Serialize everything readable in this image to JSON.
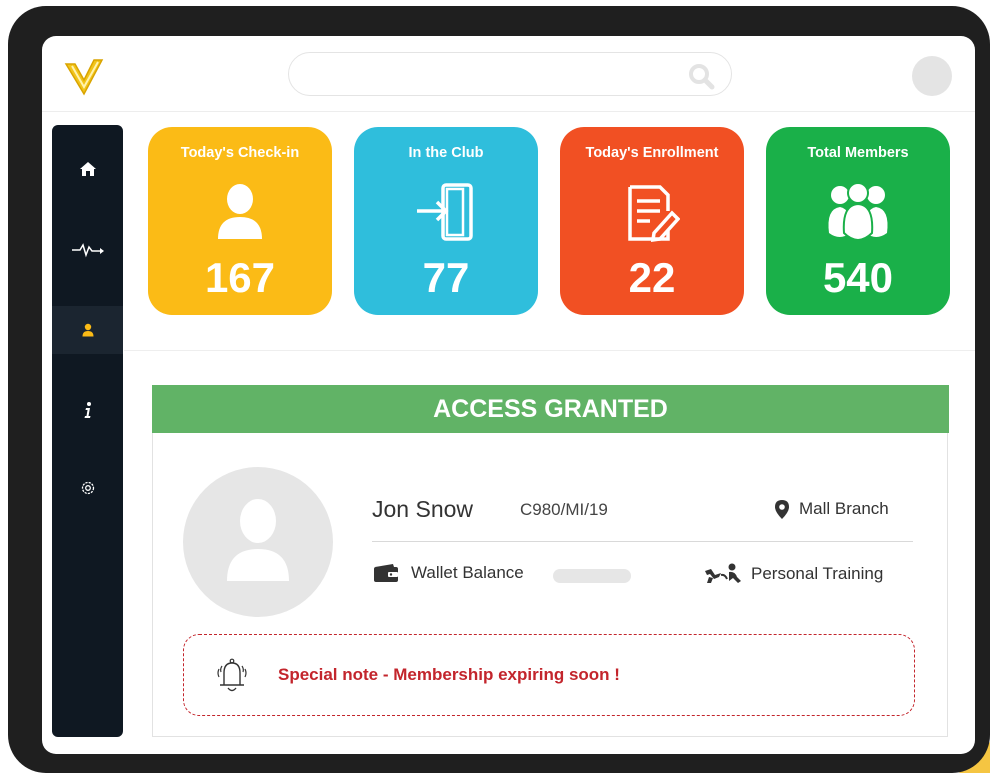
{
  "header": {
    "logo": "app-logo",
    "search_placeholder": ""
  },
  "sidebar": {
    "items": [
      {
        "name": "home",
        "icon": "home-icon",
        "active": false
      },
      {
        "name": "activity",
        "icon": "pulse-icon",
        "active": false
      },
      {
        "name": "members",
        "icon": "user-icon",
        "active": true
      },
      {
        "name": "info",
        "icon": "info-icon",
        "active": false
      },
      {
        "name": "settings",
        "icon": "gear-icon",
        "active": false
      }
    ]
  },
  "stats": [
    {
      "title": "Today's Check-in",
      "value": "167",
      "icon": "person-icon",
      "color": "#fbbb16"
    },
    {
      "title": "In the Club",
      "value": "77",
      "icon": "door-enter-icon",
      "color": "#2fbedc"
    },
    {
      "title": "Today's Enrollment",
      "value": "22",
      "icon": "form-edit-icon",
      "color": "#f15023"
    },
    {
      "title": "Total Members",
      "value": "540",
      "icon": "group-icon",
      "color": "#1ab049"
    }
  ],
  "access": {
    "status": "ACCESS GRANTED",
    "status_color": "#61b366",
    "member": {
      "name": "Jon Snow",
      "id": "C980/MI/19",
      "branch": "Mall Branch",
      "wallet_label": "Wallet Balance",
      "plan": "Personal Training"
    },
    "note": "Special note - Membership expiring soon !",
    "note_color": "#c3252c"
  }
}
